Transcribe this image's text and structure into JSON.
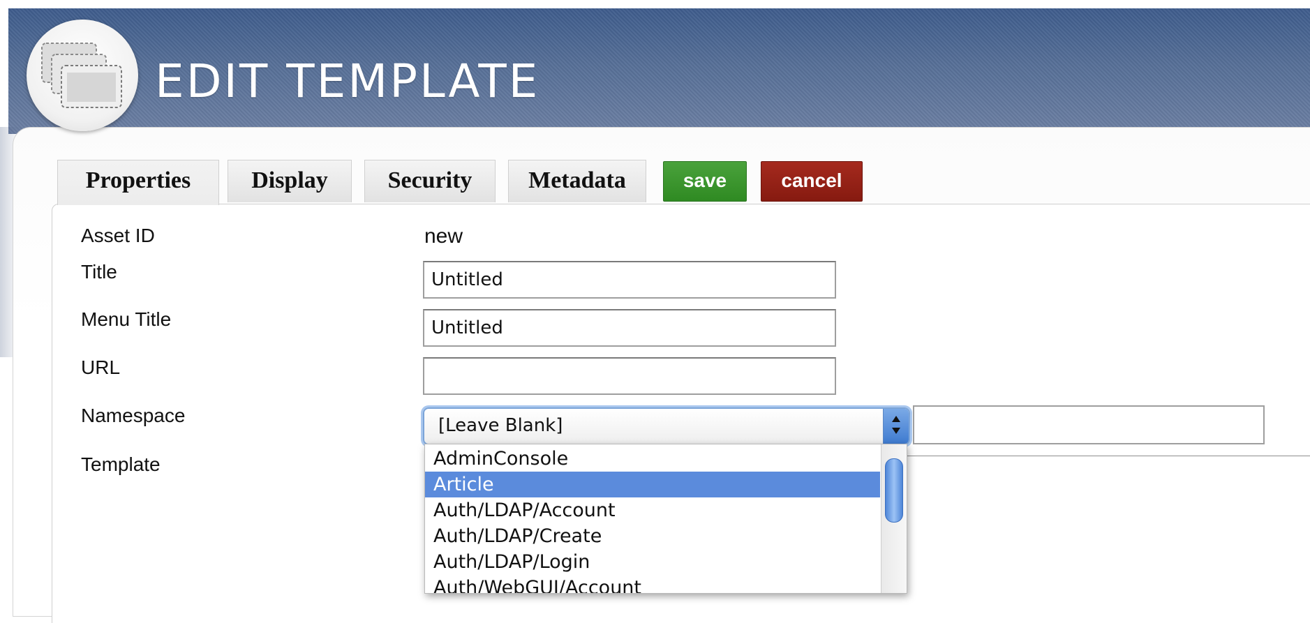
{
  "header": {
    "title": "EDIT TEMPLATE",
    "logo_icon": "stacked-windows-icon"
  },
  "tabs": [
    {
      "label": "Properties",
      "active": true
    },
    {
      "label": "Display",
      "active": false
    },
    {
      "label": "Security",
      "active": false
    },
    {
      "label": "Metadata",
      "active": false
    }
  ],
  "actions": {
    "save_label": "save",
    "cancel_label": "cancel",
    "save_color": "#3a9a2e",
    "cancel_color": "#961f14"
  },
  "form": {
    "asset_id": {
      "label": "Asset ID",
      "value": "new"
    },
    "title": {
      "label": "Title",
      "value": "Untitled"
    },
    "menu_title": {
      "label": "Menu Title",
      "value": "Untitled"
    },
    "url": {
      "label": "URL",
      "value": ""
    },
    "namespace": {
      "label": "Namespace",
      "selected": "[Leave Blank]",
      "extra_value": ""
    },
    "template": {
      "label": "Template"
    }
  },
  "dropdown": {
    "options": [
      "AdminConsole",
      "Article",
      "Auth/LDAP/Account",
      "Auth/LDAP/Create",
      "Auth/LDAP/Login",
      "Auth/WebGUI/Account"
    ],
    "highlighted": "Article",
    "highlight_color": "#5b8bdc"
  }
}
